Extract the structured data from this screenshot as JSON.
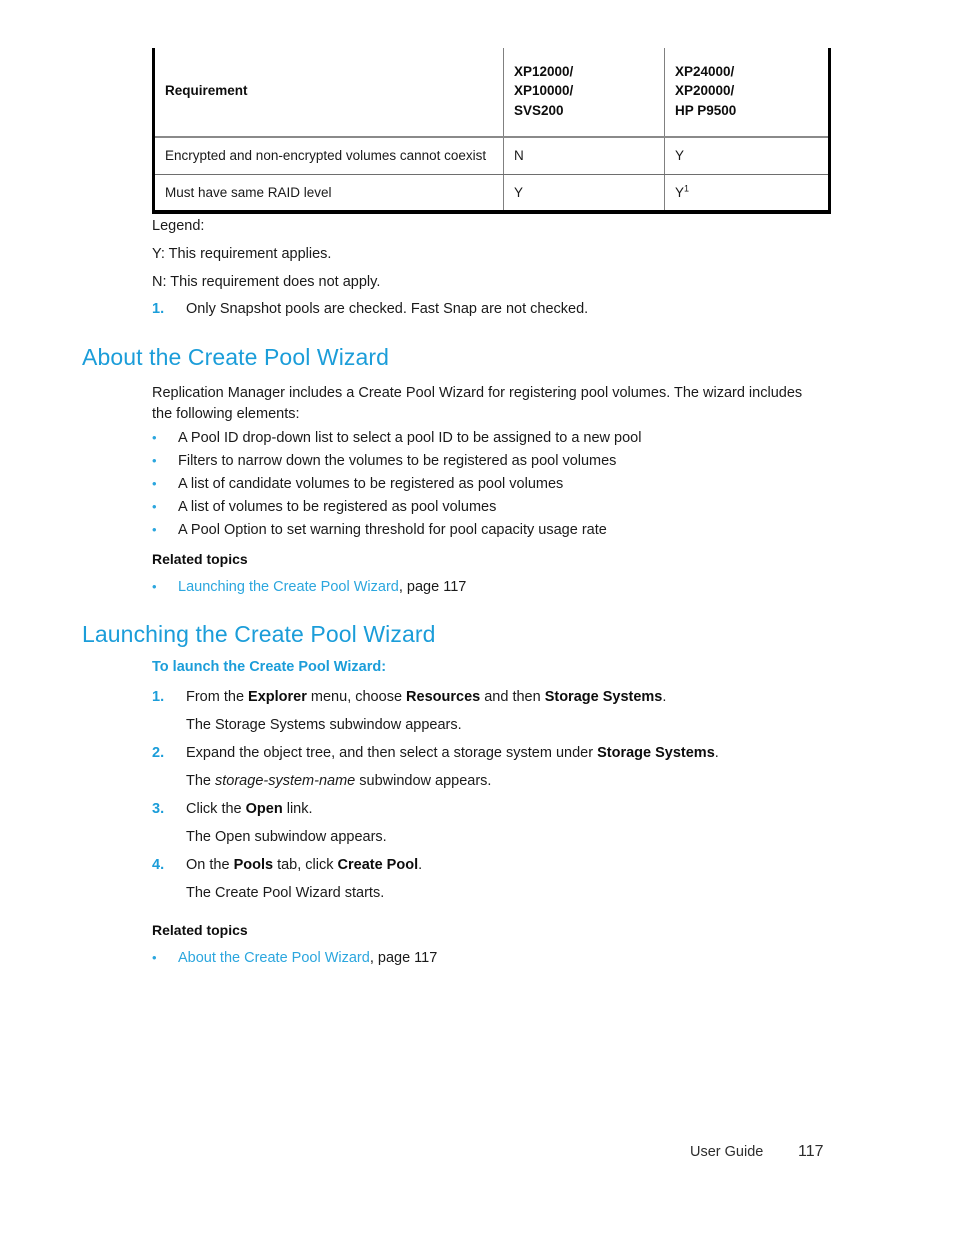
{
  "table": {
    "headers": [
      "Requirement",
      "XP12000/\nXP10000/\nSVS200",
      "XP24000/\nXP20000/\nHP P9500"
    ],
    "header_col1": "Requirement",
    "header_col2_lines": [
      "XP12000/",
      "XP10000/",
      "SVS200"
    ],
    "header_col3_lines": [
      "XP24000/",
      "XP20000/",
      "HP P9500"
    ],
    "rows": [
      {
        "requirement": "Encrypted and non-encrypted volumes cannot coexist",
        "col2": "N",
        "col3": "Y",
        "col3_sup": ""
      },
      {
        "requirement": "Must have same RAID level",
        "col2": "Y",
        "col3": "Y",
        "col3_sup": "1"
      }
    ]
  },
  "legend": {
    "title": "Legend:",
    "line_y": "Y: This requirement applies.",
    "line_n": "N: This requirement does not apply.",
    "footnote_num": "1.",
    "footnote_text": "Only Snapshot pools are checked. Fast Snap are not checked."
  },
  "section_about": {
    "heading": "About the Create Pool Wizard",
    "intro_line1": "Replication Manager includes a Create Pool Wizard for registering pool volumes. The wizard includes",
    "intro_line2": "the following elements:",
    "bullets": [
      "A Pool ID drop-down list to select a pool ID to be assigned to a new pool",
      "Filters to narrow down the volumes to be registered as pool volumes",
      "A list of candidate volumes to be registered as pool volumes",
      "A list of volumes to be registered as pool volumes",
      "A Pool Option to set warning threshold for pool capacity usage rate"
    ],
    "related_heading": "Related topics",
    "related_link": "Launching the Create Pool Wizard",
    "related_suffix": ", page 117"
  },
  "section_launching": {
    "heading": "Launching the Create Pool Wizard",
    "subheading": "To launch the Create Pool Wizard:",
    "steps": [
      {
        "num": "1.",
        "pre": "From the ",
        "b1": "Explorer",
        "mid1": " menu, choose ",
        "b2": "Resources",
        "mid2": " and then ",
        "b3": "Storage Systems",
        "post": ".",
        "result": "The Storage Systems subwindow appears."
      },
      {
        "num": "2.",
        "pre": "Expand the object tree, and then select a storage system under ",
        "b1": "Storage Systems",
        "post": ".",
        "result_pre": "The ",
        "result_italic": "storage-system-name",
        "result_post": " subwindow appears."
      },
      {
        "num": "3.",
        "pre": "Click the ",
        "b1": "Open",
        "post": " link.",
        "result": "The Open subwindow appears."
      },
      {
        "num": "4.",
        "pre": "On the ",
        "b1": "Pools",
        "mid1": " tab, click ",
        "b2": "Create Pool",
        "post": ".",
        "result": "The Create Pool Wizard starts."
      }
    ],
    "related_heading": "Related topics",
    "related_link": "About the Create Pool Wizard",
    "related_suffix": ", page 117"
  },
  "footer": {
    "guide": "User Guide",
    "page_number": "117"
  },
  "colors": {
    "accent_blue": "#1b9dd9",
    "link_blue": "#2ba6de",
    "text": "#1a1a1a"
  }
}
